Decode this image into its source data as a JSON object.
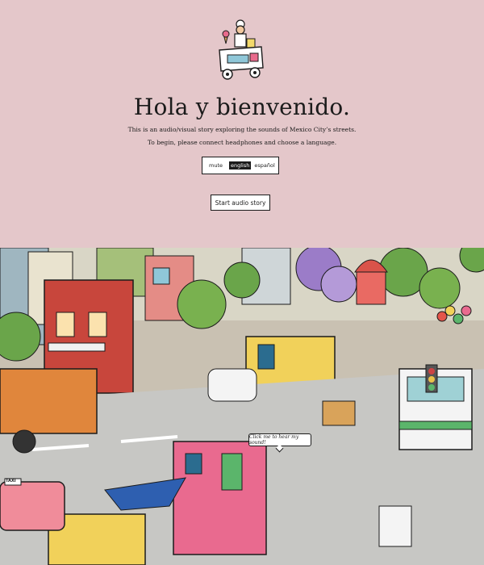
{
  "intro": {
    "title": "Hola y bienvenido.",
    "description_1": "This is an audio/visual story exploring the sounds of Mexico City’s streets.",
    "description_2": "To begin, please connect headphones and choose a language.",
    "language": {
      "mute_label": "mute",
      "english_label": "english",
      "spanish_label": "español",
      "selected": "english"
    },
    "start_button_label": "Start audio story"
  },
  "scene": {
    "tooltip": "Click me to hear my sound!",
    "taxi_label": "TAXI"
  },
  "colors": {
    "background": "#e4c7ca",
    "text": "#1b1b1b",
    "accent": "#1b1b1b"
  }
}
